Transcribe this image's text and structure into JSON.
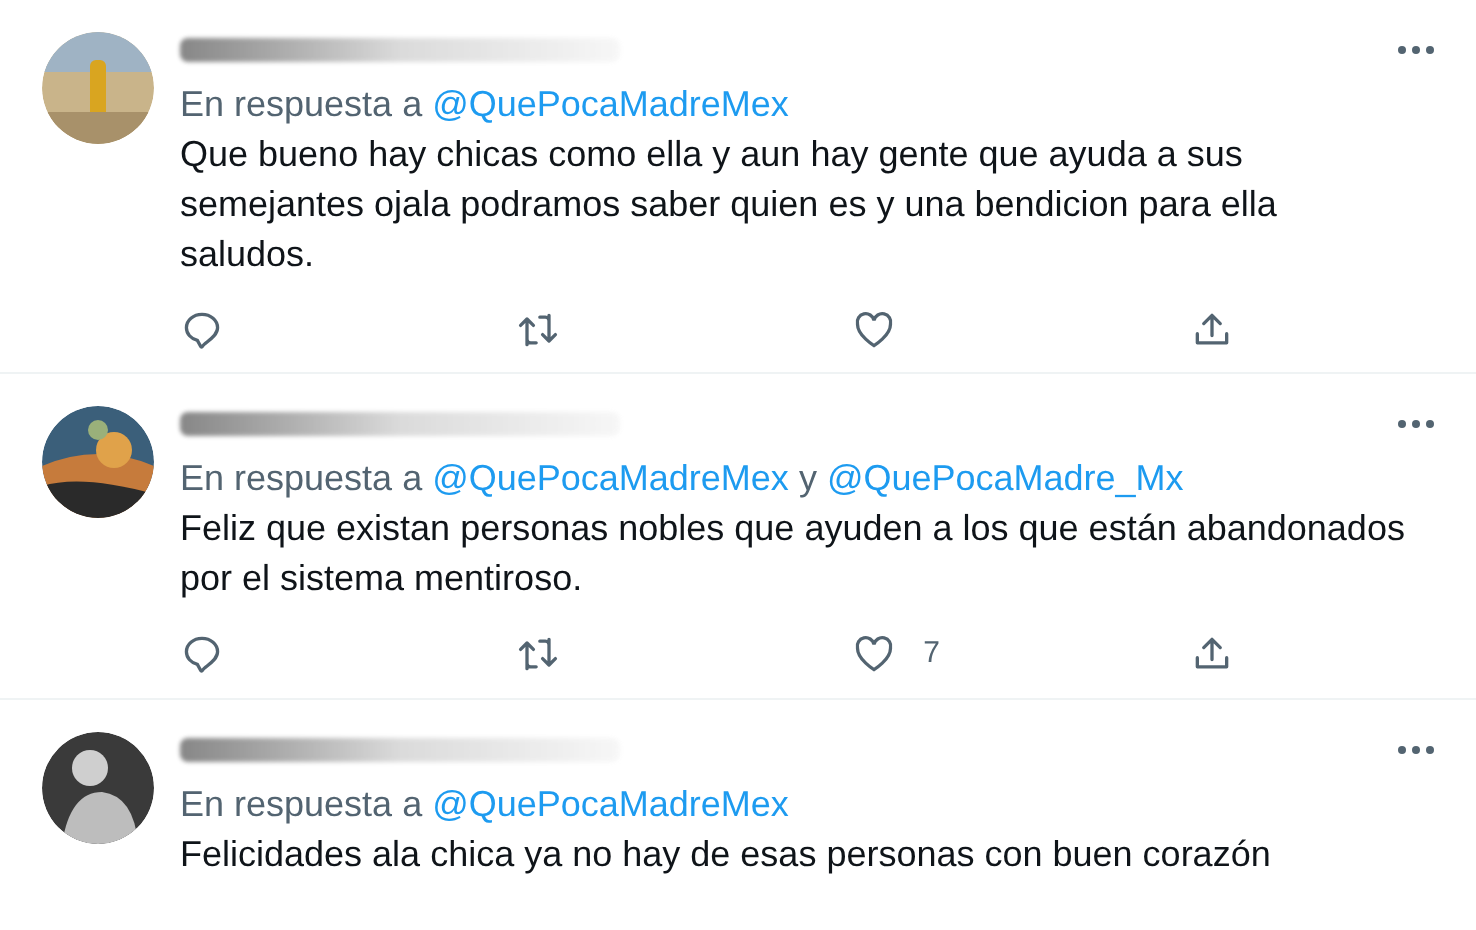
{
  "tweets": [
    {
      "reply_prefix": "En respuesta a",
      "mentions": [
        "@QuePocaMadreMex"
      ],
      "text": "Que bueno hay chicas como ella y aun hay gente que ayuda a sus semejantes ojala podramos saber quien es y una bendicion para ella saludos.",
      "show_actions": true
    },
    {
      "reply_prefix": "En respuesta a",
      "mentions": [
        "@QuePocaMadreMex",
        "@QuePocaMadre_Mx"
      ],
      "joiner": "y",
      "text": "Feliz que existan personas nobles que ayuden a los que están abandonados por el sistema mentiroso.",
      "show_actions": true,
      "like_count": "7"
    },
    {
      "reply_prefix": "En respuesta a",
      "mentions": [
        "@QuePocaMadreMex"
      ],
      "text": "Felicidades ala chica ya no hay de esas personas con buen corazón",
      "show_actions": false
    }
  ]
}
